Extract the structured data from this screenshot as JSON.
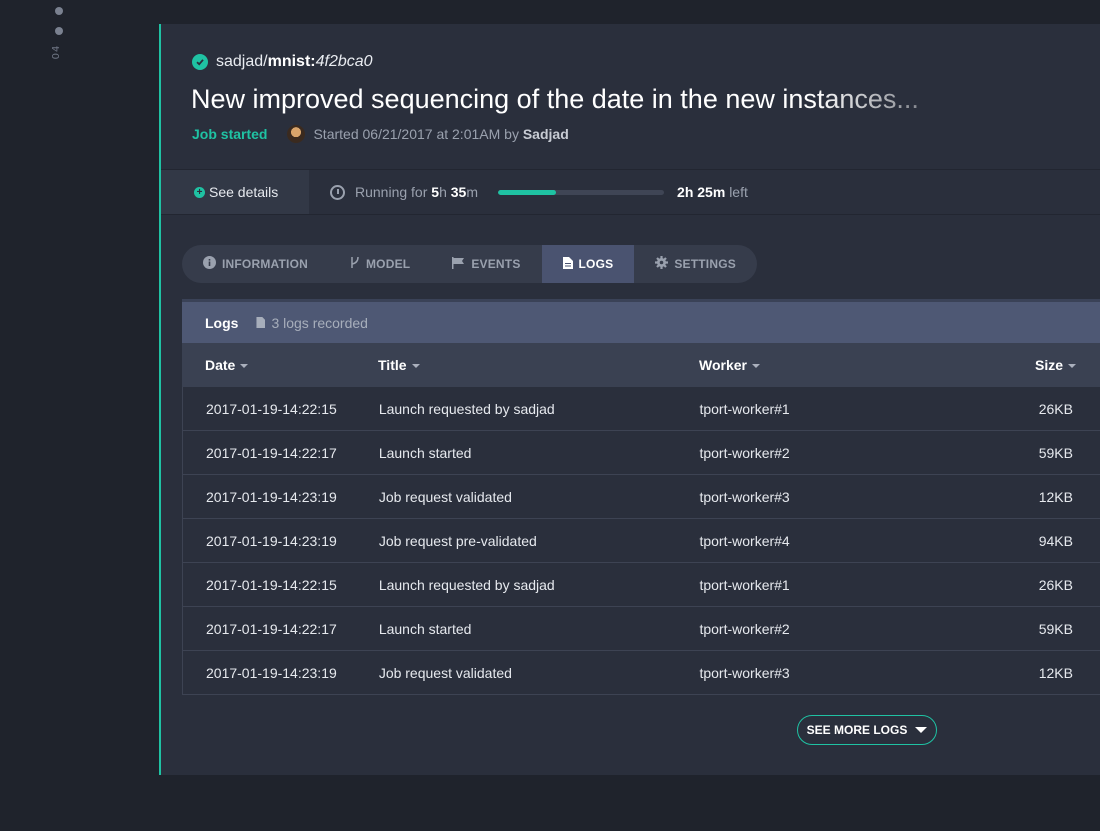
{
  "rail": {
    "label": "04"
  },
  "job": {
    "owner": "sadjad/",
    "project": "mnist:",
    "commit": "4f2bca0",
    "title": "New improved sequencing of the date in the new instances...",
    "status": "Job started",
    "started_prefix": "Started 06/21/2017 at 2:01AM by",
    "started_by": "Sadjad"
  },
  "runbar": {
    "details_label": "See details",
    "running_prefix": "Running for",
    "running_h": "5",
    "running_m": "35",
    "progress": 0.35,
    "left_h": "2",
    "left_m": "25",
    "left_suffix": "left"
  },
  "tabs": [
    {
      "label": "INFORMATION",
      "icon": "info-icon"
    },
    {
      "label": "MODEL",
      "icon": "branch-icon"
    },
    {
      "label": "EVENTS",
      "icon": "flag-icon"
    },
    {
      "label": "LOGS",
      "icon": "document-icon",
      "active": true
    },
    {
      "label": "SETTINGS",
      "icon": "gear-icon"
    }
  ],
  "logs": {
    "title": "Logs",
    "count_label": "3 logs recorded",
    "columns": [
      "Date",
      "Title",
      "Worker",
      "Size"
    ],
    "rows": [
      [
        "2017-01-19-14:22:15",
        "Launch requested by sadjad",
        "tport-worker#1",
        "26KB"
      ],
      [
        "2017-01-19-14:22:17",
        "Launch started",
        "tport-worker#2",
        "59KB"
      ],
      [
        "2017-01-19-14:23:19",
        "Job request validated",
        "tport-worker#3",
        "12KB"
      ],
      [
        "2017-01-19-14:23:19",
        "Job request pre-validated",
        "tport-worker#4",
        "94KB"
      ],
      [
        "2017-01-19-14:22:15",
        "Launch requested by sadjad",
        "tport-worker#1",
        "26KB"
      ],
      [
        "2017-01-19-14:22:17",
        "Launch started",
        "tport-worker#2",
        "59KB"
      ],
      [
        "2017-01-19-14:23:19",
        "Job request validated",
        "tport-worker#3",
        "12KB"
      ]
    ],
    "more_label": "SEE MORE LOGS"
  },
  "colors": {
    "accent": "#1fc2a3",
    "background": "#1f232c",
    "card": "#2a2f3c"
  }
}
